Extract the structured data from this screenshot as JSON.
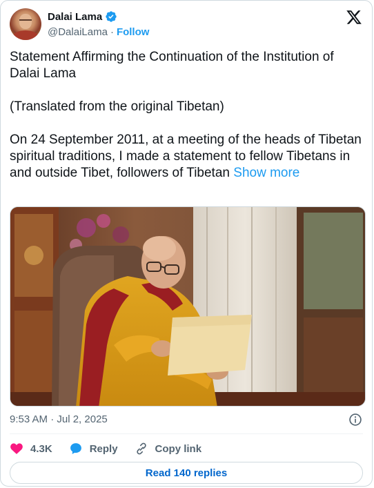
{
  "author": {
    "name": "Dalai Lama",
    "handle": "@DalaiLama",
    "separator": "·",
    "follow_label": "Follow"
  },
  "tweet": {
    "paragraph_1": "Statement Affirming the Continuation of the Institution of Dalai Lama",
    "paragraph_2": "(Translated from the original Tibetan)",
    "paragraph_3": "On 24 September 2011, at a meeting of the heads of Tibetan spiritual traditions, I made a statement to fellow Tibetans in and outside Tibet, followers of Tibetan",
    "show_more_label": "Show more"
  },
  "meta": {
    "timestamp": "9:53 AM · Jul 2, 2025"
  },
  "actions": {
    "like_count": "4.3K",
    "reply_label": "Reply",
    "copy_link_label": "Copy link"
  },
  "read_replies_label": "Read 140 replies",
  "colors": {
    "accent": "#1d9bf0",
    "like": "#f91880",
    "reply_icon": "#1d9bf0",
    "read_button_text": "#0066cc",
    "muted": "#536471"
  },
  "icons": {
    "verified": "verified-badge-icon",
    "platform": "x-logo-icon",
    "info": "info-icon",
    "like": "heart-icon",
    "reply": "speech-bubble-icon",
    "copy_link": "link-icon"
  }
}
